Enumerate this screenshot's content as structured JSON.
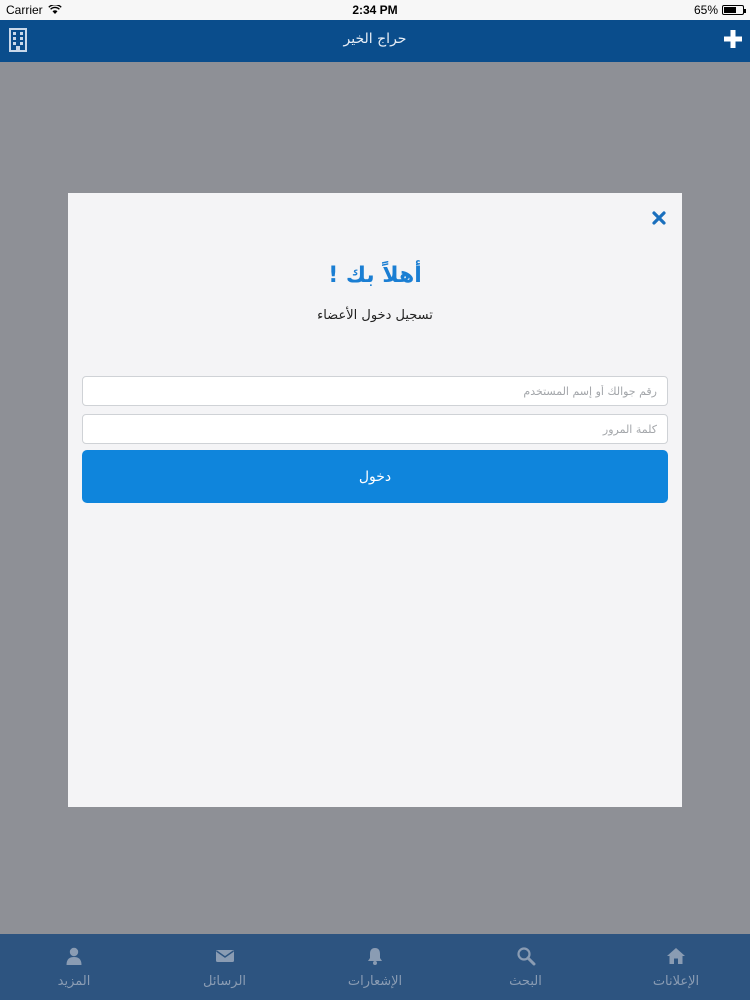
{
  "status_bar": {
    "carrier": "Carrier",
    "time": "2:34 PM",
    "battery_text": "65%",
    "battery_level": 0.65
  },
  "nav_bar": {
    "title": "حراج الخير",
    "left_icon": "building-icon",
    "right_icon": "plus-icon"
  },
  "modal": {
    "close_icon": "close-icon",
    "welcome": "أهلاً بك !",
    "subtitle": "تسجيل دخول الأعضاء",
    "username": {
      "value": "",
      "placeholder": "رقم جوالك أو إسم المستخدم"
    },
    "password": {
      "value": "",
      "placeholder": "كلمة المرور"
    },
    "login_label": "دخول"
  },
  "tab_bar": {
    "items": [
      {
        "label": "الإعلانات",
        "icon": "home-icon"
      },
      {
        "label": "البحث",
        "icon": "search-icon"
      },
      {
        "label": "الإشعارات",
        "icon": "bell-icon"
      },
      {
        "label": "الرسائل",
        "icon": "envelope-icon"
      },
      {
        "label": "المزيد",
        "icon": "user-icon"
      }
    ]
  },
  "colors": {
    "nav": "#0a4d8c",
    "tab_bar": "#2d5480",
    "accent": "#1a7ed3",
    "button": "#0f85dc"
  }
}
